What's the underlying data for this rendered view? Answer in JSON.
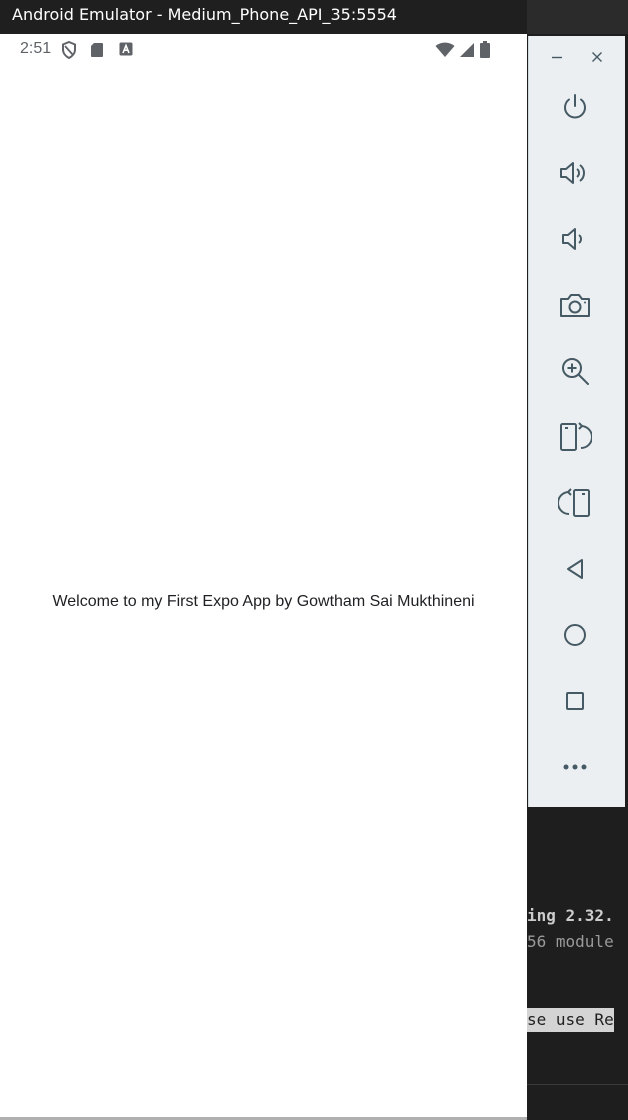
{
  "window": {
    "title": "Android Emulator - Medium_Phone_API_35:5554"
  },
  "status_bar": {
    "time": "2:51",
    "left_icons": [
      "shield-icon",
      "sd-card-icon",
      "a-badge-icon"
    ],
    "right_icons": [
      "wifi-icon",
      "signal-icon",
      "battery-icon"
    ]
  },
  "app": {
    "welcome_text": "Welcome to my First Expo App by Gowtham Sai Mukthineni"
  },
  "toolbar": {
    "window_controls": [
      "minimize-icon",
      "close-icon"
    ],
    "buttons": [
      {
        "name": "power-button",
        "icon": "power-icon"
      },
      {
        "name": "volume-up-button",
        "icon": "volume-up-icon"
      },
      {
        "name": "volume-down-button",
        "icon": "volume-down-icon"
      },
      {
        "name": "screenshot-button",
        "icon": "camera-icon"
      },
      {
        "name": "zoom-button",
        "icon": "zoom-in-icon"
      },
      {
        "name": "rotate-right-button",
        "icon": "rotate-right-icon"
      },
      {
        "name": "rotate-left-button",
        "icon": "rotate-left-icon"
      },
      {
        "name": "back-button",
        "icon": "back-triangle-icon"
      },
      {
        "name": "home-button",
        "icon": "home-circle-icon"
      },
      {
        "name": "overview-button",
        "icon": "overview-square-icon"
      },
      {
        "name": "more-button",
        "icon": "more-dots-icon"
      }
    ]
  },
  "terminal": {
    "line1": "ing 2.32.",
    "line2": "56 module",
    "line3": "se use Re"
  },
  "colors": {
    "title_bar_bg": "#1f1f1f",
    "toolbar_bg": "#eceff1",
    "toolbar_icon": "#455a64",
    "status_icon": "#5f6368",
    "terminal_bg": "#1e1e1e"
  }
}
